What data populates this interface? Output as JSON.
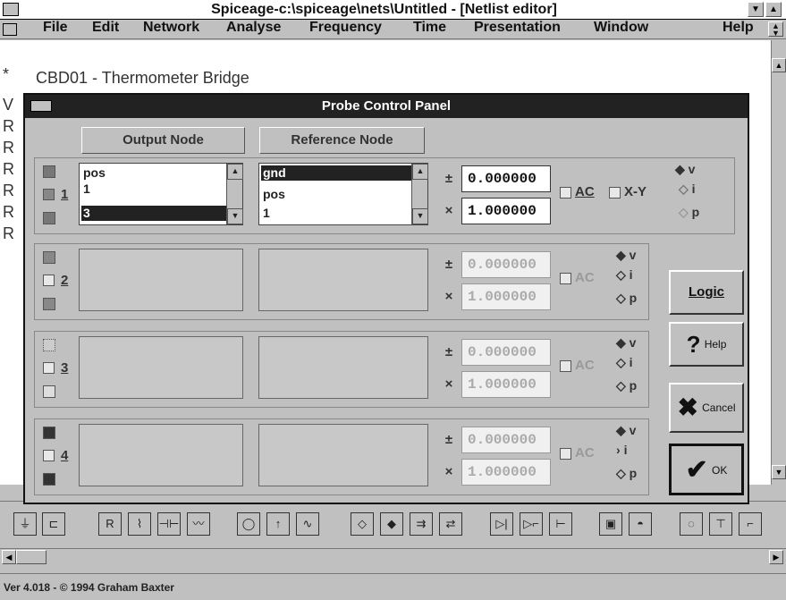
{
  "window": {
    "title": "Spiceage-c:\\spiceage\\nets\\Untitled - [Netlist editor]"
  },
  "menu": [
    "File",
    "Edit",
    "Network",
    "Analyse",
    "Frequency",
    "Time",
    "Presentation",
    "Window",
    "Help"
  ],
  "document": {
    "title_line": "CBD01 - Thermometer Bridge",
    "left_chars": [
      "*",
      "V",
      "R",
      "R",
      "R",
      "R",
      "R",
      "R"
    ]
  },
  "dialog": {
    "title": "Probe Control Panel",
    "headers": {
      "output": "Output Node",
      "reference": "Reference Node"
    },
    "probes": [
      {
        "number": "1",
        "output_items": [
          "pos",
          "1",
          "3"
        ],
        "output_selected": 2,
        "reference_items": [
          "gnd",
          "pos",
          "1"
        ],
        "reference_selected": 0,
        "offset": "0.000000",
        "scale": "1.000000",
        "ac": "AC",
        "xy": "X-Y",
        "modes": [
          "v",
          "i",
          "p"
        ],
        "active": true
      },
      {
        "number": "2",
        "offset": "0.000000",
        "scale": "1.000000",
        "ac": "AC",
        "modes": [
          "v",
          "i",
          "p"
        ],
        "active": false
      },
      {
        "number": "3",
        "offset": "0.000000",
        "scale": "1.000000",
        "ac": "AC",
        "modes": [
          "v",
          "i",
          "p"
        ],
        "active": false
      },
      {
        "number": "4",
        "offset": "0.000000",
        "scale": "1.000000",
        "ac": "AC",
        "modes": [
          "v",
          "i",
          "p"
        ],
        "active": false
      }
    ],
    "symbols": {
      "offset": "±",
      "scale": "×"
    },
    "buttons": {
      "logic": "Logic",
      "help": "Help",
      "cancel": "Cancel",
      "ok": "OK"
    }
  },
  "status": {
    "text": "Ver 4.018 - © 1994 Graham Baxter"
  },
  "colors": {
    "dialog_title_bg": "#222222",
    "window_bg": "#c0c0c0"
  }
}
